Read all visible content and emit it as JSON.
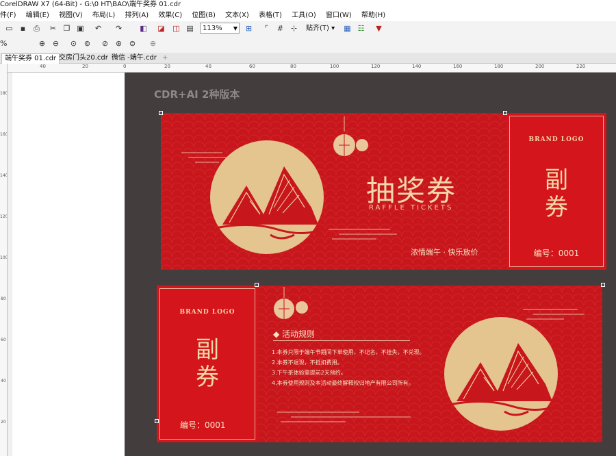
{
  "window": {
    "title": "CorelDRAW X7 (64-Bit) - G:\\0 HT\\BAO\\端午奖券 01.cdr"
  },
  "menu": [
    "件(F)",
    "编辑(E)",
    "视图(V)",
    "布局(L)",
    "排列(A)",
    "效果(C)",
    "位图(B)",
    "文本(X)",
    "表格(T)",
    "工具(O)",
    "窗口(W)",
    "帮助(H)"
  ],
  "toolbar": {
    "zoom": "113%",
    "snap": "贴齐(T)",
    "zoom2": "%"
  },
  "tabs": [
    "端午奖券 01.cdr",
    "交房门头20.cdr",
    "微信 -端午.cdr"
  ],
  "ruler": {
    "h": [
      "40",
      "20",
      "0",
      "20",
      "40",
      "60",
      "80",
      "100",
      "120",
      "140",
      "160",
      "180",
      "200",
      "220"
    ],
    "v": [
      "180",
      "160",
      "140",
      "120",
      "100",
      "80",
      "60",
      "40",
      "20"
    ]
  },
  "caption": "CDR+AI 2种版本",
  "ticket1": {
    "title": "抽奖券",
    "subtitle": "RAFFLE TICKETS",
    "slogan": "浓情端午 · 快乐放价",
    "brand": "BRAND LOGO",
    "stub": "副\n券",
    "number": "编号：0001"
  },
  "ticket2": {
    "brand": "BRAND LOGO",
    "stub": "副\n券",
    "number": "编号：0001",
    "rules_title": "活动规则",
    "rules": [
      "1.本券只限于端午节期间下单使用，不记名，不挂失，不兑现。",
      "2.本券不退现，不抵扣费用。",
      "3.下午茶体验需提前2天预约。",
      "4.本券使用规则及本活动最终解释权归地产有限公司所有。"
    ]
  },
  "colors": {
    "ticket_red": "#c8161d",
    "gold": "#e9c79a",
    "canvas_dark": "#433d3d"
  }
}
